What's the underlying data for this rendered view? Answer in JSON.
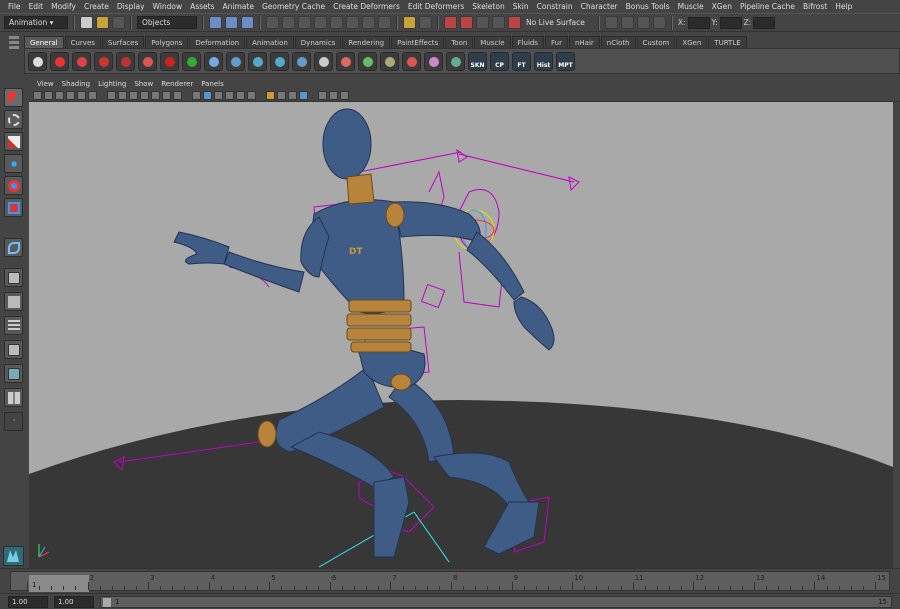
{
  "menu": [
    "File",
    "Edit",
    "Modify",
    "Create",
    "Display",
    "Window",
    "Assets",
    "Animate",
    "Geometry Cache",
    "Create Deformers",
    "Edit Deformers",
    "Skeleton",
    "Skin",
    "Constrain",
    "Character",
    "Bonus Tools",
    "Muscle",
    "XGen",
    "Pipeline Cache",
    "Bifrost",
    "Help"
  ],
  "status": {
    "menu_set": "Animation",
    "selection_mask": "Objects",
    "live_surface": "No Live Surface",
    "x_label": "X:",
    "y_label": "Y:",
    "z_label": "Z:"
  },
  "shelf_tabs": [
    {
      "label": "General",
      "active": true
    },
    {
      "label": "Curves"
    },
    {
      "label": "Surfaces"
    },
    {
      "label": "Polygons"
    },
    {
      "label": "Deformation"
    },
    {
      "label": "Animation"
    },
    {
      "label": "Dynamics"
    },
    {
      "label": "Rendering"
    },
    {
      "label": "PaintEffects"
    },
    {
      "label": "Toon"
    },
    {
      "label": "Muscle"
    },
    {
      "label": "Fluids"
    },
    {
      "label": "Fur"
    },
    {
      "label": "nHair"
    },
    {
      "label": "nCloth"
    },
    {
      "label": "Custom"
    },
    {
      "label": "XGen"
    },
    {
      "label": "TURTLE"
    }
  ],
  "shelf_labels": [
    "SKN",
    "CP",
    "FT",
    "Hist",
    "MPT"
  ],
  "viewport_menu": [
    "View",
    "Shading",
    "Lighting",
    "Show",
    "Renderer",
    "Panels"
  ],
  "character_logo": "DT",
  "colors": {
    "viewport_bg": "#a9a9a9",
    "ground": "#373737",
    "body": "#3f5c86",
    "joint": "#b8843c",
    "rig": "#c000c0"
  },
  "timeslider": {
    "ticks": [
      "1",
      "2",
      "3",
      "4",
      "5",
      "6",
      "7",
      "8",
      "9",
      "10",
      "11",
      "12",
      "13",
      "14",
      "15"
    ],
    "current_frame": "1"
  },
  "range": {
    "start": "1.00",
    "anim_start": "1.00",
    "range_start": "1",
    "range_end": "15"
  }
}
